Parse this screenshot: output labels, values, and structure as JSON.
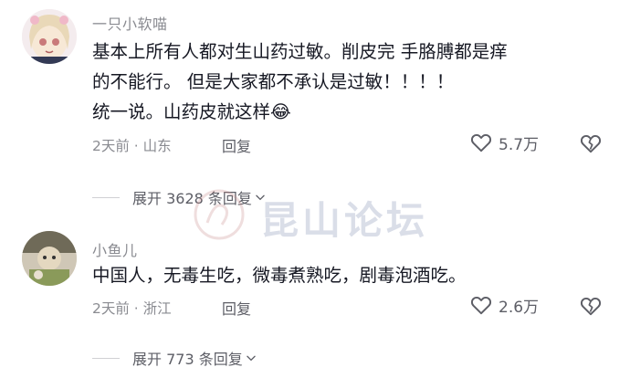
{
  "comments": [
    {
      "username": "一只小软喵",
      "text": "基本上所有人都对生山药过敏。削皮完 手胳膊都是痒\n的不能行。 但是大家都不承认是过敏！！！！\n统一说。山药皮就这样",
      "emoji": "😂",
      "meta": "2天前 · 山东",
      "reply_label": "回复",
      "likes": "5.7万",
      "expand_label": "展开 3628 条回复"
    },
    {
      "username": "小鱼儿",
      "text": "中国人，无毒生吃，微毒煮熟吃，剧毒泡酒吃。",
      "meta": "2天前 · 浙江",
      "reply_label": "回复",
      "likes": "2.6万",
      "expand_label": "展开 773 条回复"
    }
  ],
  "watermark": {
    "text": "昆山论坛"
  },
  "colors": {
    "secondary_text": "#8a8b91",
    "primary_text": "#161823",
    "watermark": "#7d8bb0"
  },
  "icons": [
    "avatar",
    "heart-outline-icon",
    "broken-heart-icon",
    "chevron-down-icon",
    "watermark-logo-icon"
  ]
}
